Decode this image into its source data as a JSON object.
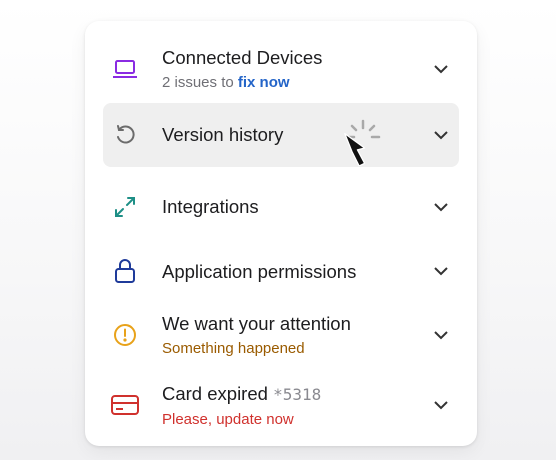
{
  "items": [
    {
      "title": "Connected Devices",
      "sub_prefix": "2 issues to ",
      "sub_link": "fix now",
      "icon": "laptop-icon",
      "icon_color": "#8a2be2"
    },
    {
      "title": "Version history",
      "icon": "history-icon",
      "icon_color": "#6b6b6b",
      "active": true,
      "loading": true
    },
    {
      "title": "Integrations",
      "icon": "expand-arrows-icon",
      "icon_color": "#1e8f86"
    },
    {
      "title": "Application permissions",
      "icon": "lock-icon",
      "icon_color": "#1f3b9a"
    },
    {
      "title": "We want your attention",
      "sub": "Something happened",
      "sub_color": "#9a5b00",
      "icon": "alert-circle-icon",
      "icon_color": "#e8a21a"
    },
    {
      "title": "Card expired",
      "title_suffix": "*5318",
      "sub": "Please, update now",
      "sub_color": "#d0312d",
      "icon": "credit-card-icon",
      "icon_color": "#d0312d"
    }
  ],
  "colors": {
    "link": "#2364c8",
    "active_bg": "#efefef"
  }
}
